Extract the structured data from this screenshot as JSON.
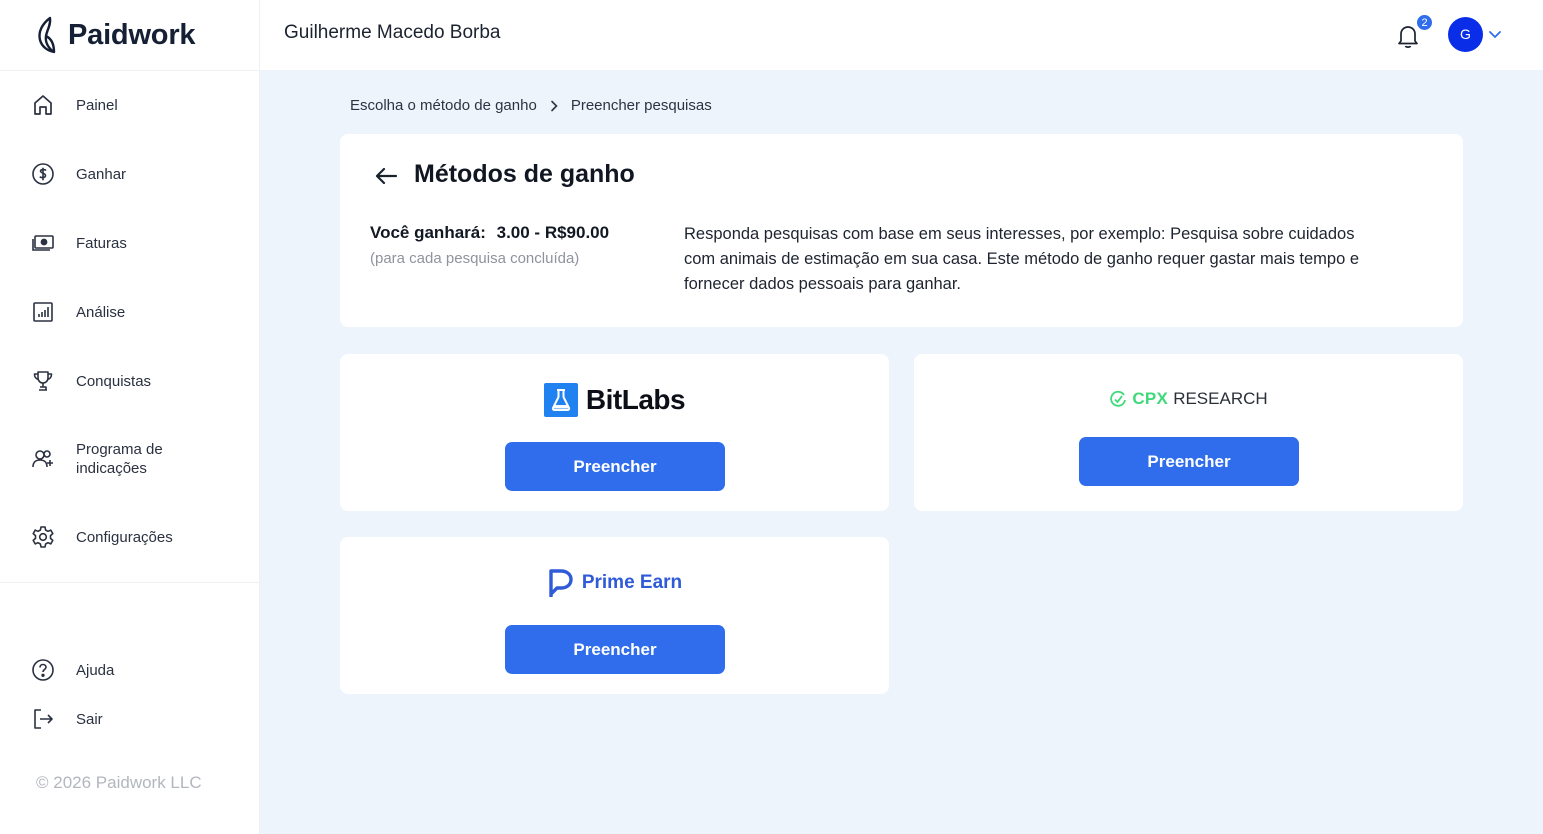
{
  "app": {
    "logo_text": "Paidwork",
    "copyright": "© 2026 Paidwork LLC"
  },
  "colors": {
    "accent": "#2f6ded",
    "avatar": "#0a2ee8",
    "cpx_green": "#3fd97a",
    "prime_blue": "#2f5ad8",
    "background": "#eef4fc"
  },
  "sidebar": {
    "items": [
      {
        "label": "Painel",
        "icon": "home-icon"
      },
      {
        "label": "Ganhar",
        "icon": "dollar-icon"
      },
      {
        "label": "Faturas",
        "icon": "banknote-icon"
      },
      {
        "label": "Análise",
        "icon": "chart-icon"
      },
      {
        "label": "Conquistas",
        "icon": "trophy-icon"
      },
      {
        "label": "Programa de indicações",
        "icon": "referral-icon"
      },
      {
        "label": "Configurações",
        "icon": "gear-icon"
      }
    ],
    "bottom": [
      {
        "label": "Ajuda",
        "icon": "help-icon"
      },
      {
        "label": "Sair",
        "icon": "logout-icon"
      }
    ]
  },
  "header": {
    "user_name": "Guilherme Macedo Borba",
    "notification_count": "2",
    "avatar_initial": "G"
  },
  "breadcrumb": {
    "items": [
      "Escolha o método de ganho",
      "Preencher pesquisas"
    ]
  },
  "info": {
    "title": "Métodos de ganho",
    "earn_label": "Você ganhará:",
    "earn_amount": "3.00 - R$90.00",
    "earn_sub": "(para cada pesquisa concluída)",
    "description": "Responda pesquisas com base em seus interesses, por exemplo: Pesquisa sobre cuidados com animais de estimação em sua casa. Este método de ganho requer gastar mais tempo e fornecer dados pessoais para ganhar."
  },
  "providers": [
    {
      "logo_part1": "Bit",
      "logo_part2": "Labs",
      "button": "Preencher"
    },
    {
      "logo_part1": "CPX",
      "logo_part2": "RESEARCH",
      "button": "Preencher"
    },
    {
      "logo_text": "Prime Earn",
      "button": "Preencher"
    }
  ]
}
